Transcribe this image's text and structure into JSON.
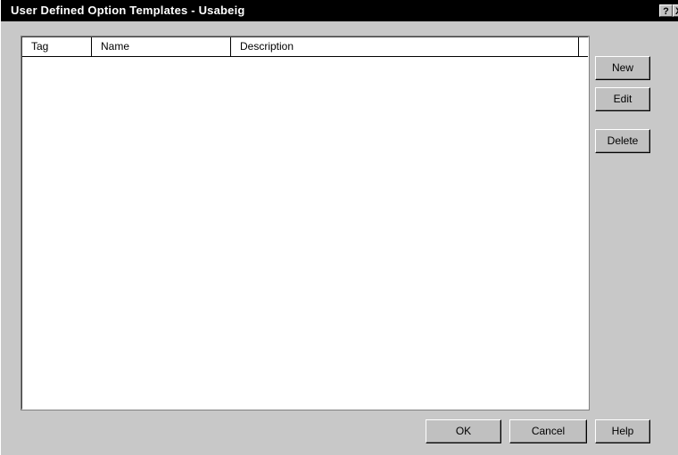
{
  "window": {
    "title": "User Defined Option Templates - Usabeig",
    "help_glyph": "?",
    "close_glyph": "X"
  },
  "list": {
    "columns": [
      "Tag",
      "Name",
      "Description"
    ],
    "rows": []
  },
  "buttons": {
    "new": "New",
    "edit": "Edit",
    "delete": "Delete",
    "ok": "OK",
    "cancel": "Cancel",
    "help": "Help"
  }
}
